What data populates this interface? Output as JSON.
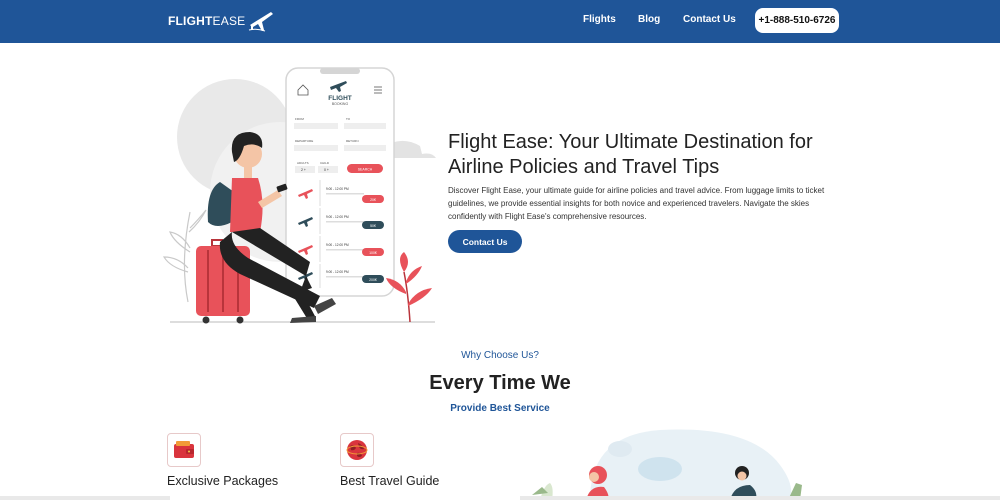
{
  "nav": {
    "logo_bold": "FLIGHT",
    "logo_light": "EASE",
    "links": [
      "Flights",
      "Blog",
      "Contact Us"
    ],
    "phone": "+1-888-510-6726"
  },
  "hero": {
    "title": "Flight Ease: Your Ultimate Destination for Airline Policies and Travel Tips",
    "description": "Discover Flight Ease, your ultimate guide for airline policies and travel advice. From luggage limits to ticket guidelines, we provide essential insights for both novice and experienced travelers. Navigate the skies confidently with Flight Ease's comprehensive resources.",
    "button": "Contact Us"
  },
  "phone_mockup": {
    "brand_top": "FLIGHT",
    "brand_bottom": "BOOKING",
    "field_from": "FROM",
    "field_to": "TO",
    "field_departure": "DEPARTURE",
    "field_return": "RETURN",
    "adults_label": "ADULTS",
    "child_label": "CHILD",
    "adults_value": "2 +",
    "child_value": "0 +",
    "search_label": "SEARCH",
    "flights": [
      {
        "time": "9:00 - 12:00 PM",
        "price": "20€",
        "color": "#e8525a"
      },
      {
        "time": "9:00 - 12:00 PM",
        "price": "50€",
        "color": "#2f4d5a"
      },
      {
        "time": "9:00 - 12:00 PM",
        "price": "100€",
        "color": "#e8525a"
      },
      {
        "time": "9:00 - 12:00 PM",
        "price": "200€",
        "color": "#2f4d5a"
      }
    ]
  },
  "why": {
    "kicker": "Why Choose Us?",
    "title": "Every Time We",
    "subtitle": "Provide Best Service"
  },
  "features": [
    {
      "title": "Exclusive Packages",
      "icon": "wallet-icon"
    },
    {
      "title": "Best Travel Guide",
      "icon": "globe-icon"
    }
  ],
  "colors": {
    "brand_blue": "#1f5598",
    "accent_red": "#e8525a",
    "dark_teal": "#2f4d5a"
  }
}
